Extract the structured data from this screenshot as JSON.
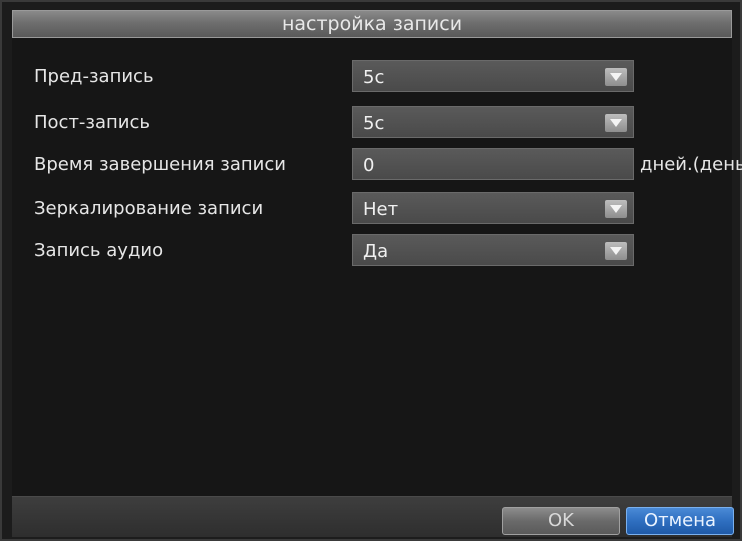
{
  "window": {
    "title": "настройка записи"
  },
  "settings": [
    {
      "label": "Пред-запись",
      "value": "5с",
      "type": "dropdown"
    },
    {
      "label": "Пост-запись",
      "value": "5с",
      "type": "dropdown"
    },
    {
      "label": "Время завершения записи",
      "value": "0",
      "type": "text",
      "unit": "дней.(день)"
    },
    {
      "label": "Зеркалирование записи",
      "value": "Нет",
      "type": "dropdown"
    },
    {
      "label": "Запись аудио",
      "value": "Да",
      "type": "dropdown"
    }
  ],
  "buttons": {
    "ok": "OK",
    "cancel": "Отмена"
  },
  "colors": {
    "accent": "#2f6fc0",
    "background": "#161616",
    "field": "#4f4f4f"
  },
  "icons": {
    "dropdown": "chevron-down-icon"
  }
}
